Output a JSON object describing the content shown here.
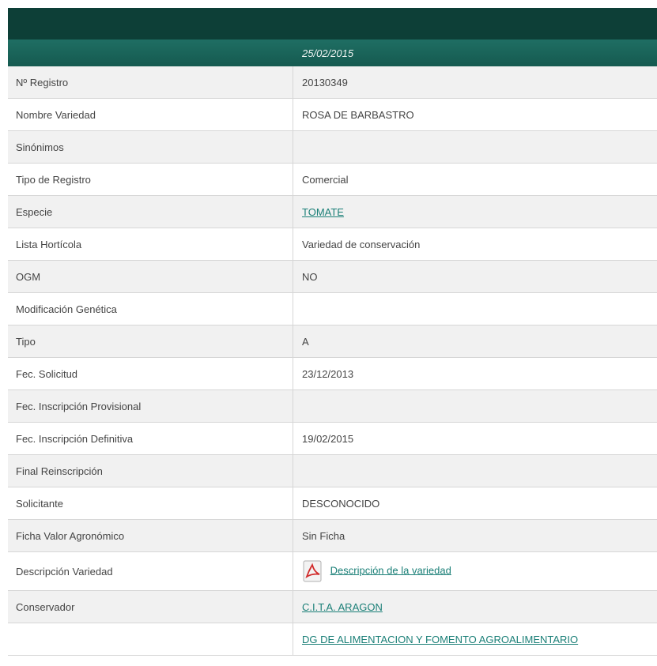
{
  "header": {
    "date": "25/02/2015"
  },
  "rows": [
    {
      "label": "Nº Registro",
      "value": "20130349"
    },
    {
      "label": "Nombre Variedad",
      "value": "ROSA DE BARBASTRO"
    },
    {
      "label": "Sinónimos",
      "value": ""
    },
    {
      "label": "Tipo de Registro",
      "value": "Comercial"
    },
    {
      "label": "Especie",
      "value": "TOMATE"
    },
    {
      "label": "Lista Hortícola",
      "value": "Variedad de conservación"
    },
    {
      "label": "OGM",
      "value": "NO"
    },
    {
      "label": "Modificación Genética",
      "value": ""
    },
    {
      "label": "Tipo",
      "value": "A"
    },
    {
      "label": "Fec. Solicitud",
      "value": "23/12/2013"
    },
    {
      "label": "Fec. Inscripción Provisional",
      "value": ""
    },
    {
      "label": "Fec. Inscripción Definitiva",
      "value": "19/02/2015"
    },
    {
      "label": "Final Reinscripción",
      "value": ""
    },
    {
      "label": "Solicitante",
      "value": "DESCONOCIDO"
    },
    {
      "label": "Ficha Valor Agronómico",
      "value": "Sin Ficha"
    },
    {
      "label": "Descripción Variedad",
      "value": " Descripción de la variedad",
      "icon": "pdf-icon"
    },
    {
      "label": "Conservador",
      "value": "C.I.T.A. ARAGON"
    },
    {
      "label": "",
      "value": "DG DE ALIMENTACION Y FOMENTO AGROALIMENTARIO"
    }
  ],
  "colors": {
    "header_dark": "#0d3f37",
    "header_green": "#1f6e63",
    "link": "#1a7f77"
  }
}
